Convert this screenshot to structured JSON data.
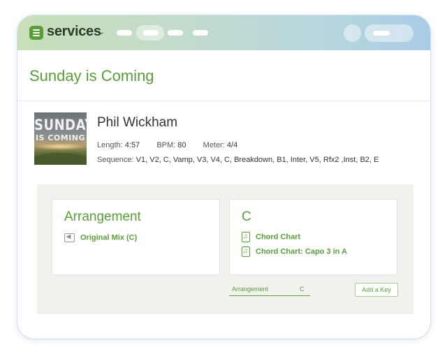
{
  "app": {
    "name": "services",
    "brand_color": "#5a9e3a"
  },
  "header": {
    "nav_placeholders": 4
  },
  "page": {
    "title": "Sunday is Coming"
  },
  "song": {
    "album_art": {
      "line1": "SUNDAY",
      "line2": "IS COMING"
    },
    "artist": "Phil Wickham",
    "length_label": "Length:",
    "length_value": "4:57",
    "bpm_label": "BPM:",
    "bpm_value": "80",
    "meter_label": "Meter:",
    "meter_value": "4/4",
    "sequence_label": "Sequence:",
    "sequence_value": "V1, V2, C, Vamp, V3, V4, C, Breakdown, B1, Inter, V5, Rfx2 ,Inst, B2, E"
  },
  "arrangement_card": {
    "title": "Arrangement",
    "items": [
      {
        "label": "Original Mix (C)",
        "icon": "speaker-icon"
      }
    ]
  },
  "key_card": {
    "title": "C",
    "items": [
      {
        "label": "Chord Chart",
        "icon": "music-doc-icon"
      },
      {
        "label": "Chord Chart: Capo 3 in A",
        "icon": "music-doc-icon"
      }
    ]
  },
  "footer": {
    "arrangement_label": "Arrangement",
    "arrangement_key": "C",
    "add_key_label": "Add a Key"
  }
}
